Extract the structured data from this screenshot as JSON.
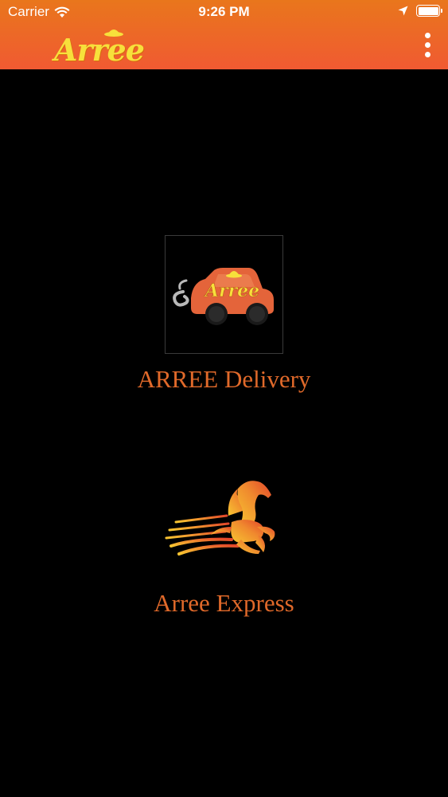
{
  "status_bar": {
    "carrier": "Carrier",
    "time": "9:26 PM"
  },
  "header": {
    "logo_text": "Arree",
    "menu_icon": "more-vertical-icon"
  },
  "services": [
    {
      "label": "ARREE Delivery",
      "icon": "delivery-car-logo",
      "logo_text": "Arree"
    },
    {
      "label": "Arree Express",
      "icon": "running-horse-logo"
    }
  ],
  "colors": {
    "header_top": "#e9761c",
    "header_bottom": "#f05a32",
    "label": "#e0692a",
    "logo_yellow": "#f7e03b",
    "background": "#000000"
  }
}
